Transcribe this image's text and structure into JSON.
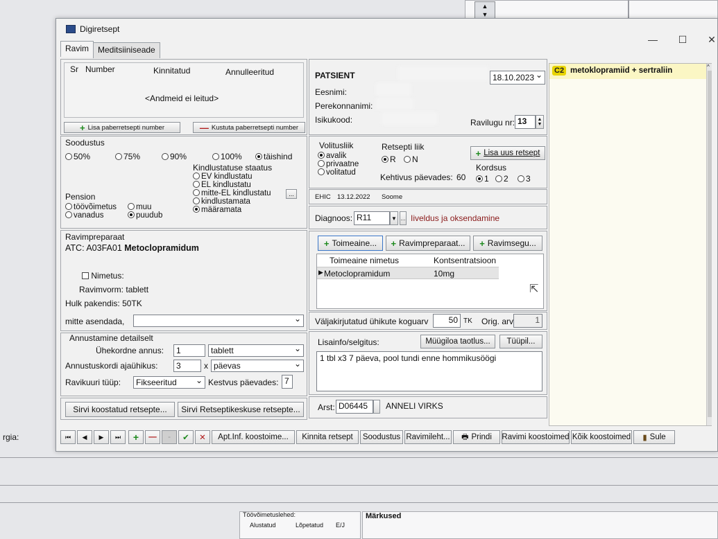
{
  "background": {
    "left_label": "rgia:",
    "lower_table": {
      "title": "Töövõimetuslehed:",
      "columns": [
        "Alustatud",
        "Lõpetatud",
        "E/J"
      ],
      "remarks": "Märkused"
    }
  },
  "window": {
    "title": "Digiretsept",
    "controls": [
      "—",
      "☐",
      "✕"
    ],
    "tabs": [
      "Ravim",
      "Meditsiiniseade"
    ]
  },
  "paper_rx": {
    "columns": [
      "Sr",
      "Number",
      "Kinnitatud",
      "Annulleeritud"
    ],
    "empty_text": "<Andmeid ei leitud>",
    "add_button": "Lisa paberretsepti number",
    "delete_button": "Kustuta paberretsepti number"
  },
  "discount": {
    "title": "Soodustus",
    "options": [
      "50%",
      "75%",
      "90%",
      "100%",
      "täishind"
    ],
    "selected": "täishind"
  },
  "insurance": {
    "title": "Kindlustatuse staatus",
    "options": [
      "EV kindlustatu",
      "EL kindlustatu",
      "mitte-EL kindlustatu",
      "kindlustamata",
      "määramata"
    ],
    "selected": "määramata"
  },
  "pension": {
    "title": "Pension",
    "options": [
      "töövõimetus",
      "muu",
      "vanadus",
      "puudub"
    ],
    "selected": "puudub"
  },
  "medicine": {
    "title": "Ravimpreparaat",
    "atc_label": "ATC:",
    "atc_code": "A03FA01",
    "atc_name": "Metoclopramidum",
    "name_label": "Nimetus:",
    "form_label": "Ravimvorm:",
    "form_value": "tablett",
    "pack_label": "Hulk pakendis:",
    "pack_value": "50TK",
    "substitute_label": "mitte asendada,"
  },
  "dosage": {
    "title": "Annustamine detailselt",
    "single_dose_label": "Ühekordne annus:",
    "single_dose_value": "1",
    "single_dose_unit": "tablett",
    "times_label": "Annustuskordi ajaühikus:",
    "times_value": "3",
    "times_x": "x",
    "time_unit": "päevas",
    "course_label": "Ravikuuri tüüp:",
    "course_value": "Fikseeritud",
    "duration_label": "Kestvus päevades:",
    "duration_value": "7"
  },
  "bottom_buttons": [
    "Sirvi koostatud retsepte...",
    "Sirvi Retseptikeskuse retsepte..."
  ],
  "patient": {
    "title": "PATSIENT",
    "date": "18.10.2023",
    "first_name_label": "Eesnimi:",
    "last_name_label": "Perekonnanimi:",
    "id_label": "Isikukood:",
    "visit_label": "Ravilugu nr:",
    "visit_value": "13"
  },
  "authorization": {
    "title": "Volitusliik",
    "options": [
      "avalik",
      "privaatne",
      "volitatud"
    ],
    "selected": "avalik"
  },
  "rx_type": {
    "title": "Retsepti liik",
    "options": [
      "R",
      "N"
    ],
    "selected": "R"
  },
  "new_rx_button": "Lisa uus retsept",
  "validity_label": "Kehtivus päevades:",
  "validity_value": "60",
  "repeats": {
    "title": "Kordsus",
    "options": [
      "1",
      "2",
      "3"
    ],
    "selected": "1"
  },
  "ehic": {
    "label": "EHIC",
    "date": "13.12.2022",
    "country": "Soome"
  },
  "diagnosis": {
    "label": "Diagnoos:",
    "code": "R11",
    "text": "Iiveldus ja oksendamine"
  },
  "substance": {
    "buttons": [
      "Toimeaine...",
      "Ravimpreparaat...",
      "Ravimsegu..."
    ],
    "columns": [
      "Toimeaine nimetus",
      "Kontsentratsioon"
    ],
    "rows": [
      {
        "name": "Metoclopramidum",
        "conc": "10mg"
      }
    ]
  },
  "quantity": {
    "label": "Väljakirjutatud ühikute koguarv",
    "value": "50",
    "unit": "TK",
    "orig_label": "Orig. arv",
    "orig_value": "1"
  },
  "info": {
    "label": "Lisainfo/selgitus:",
    "button1": "Müügiloa taotlus...",
    "button2": "Tüüpil...",
    "text": "1 tbl x3 7 päeva, pool tundi enne hommikusöögi"
  },
  "doctor": {
    "label": "Arst:",
    "code": "D06445",
    "name": "ANNELI VIRKS"
  },
  "side_panel": {
    "badge": "C2",
    "text": "metoklopramiid + sertraliin"
  },
  "toolbar": {
    "nav": [
      "⏮",
      "◀",
      "▶",
      "⏭"
    ],
    "add": "+",
    "remove": "—",
    "dash": "-",
    "confirm": "✔",
    "cancel": "✕",
    "buttons": [
      "Apt.Inf. koostoime...",
      "Kinnita retsept",
      "Soodustus",
      "Ravimileht...",
      "Prindi",
      "Ravimi koostoimed",
      "Kõik koostoimed",
      "Sule"
    ]
  },
  "colors": {
    "badge_bg": "#e8d400",
    "side_bg": "#fbf6c4",
    "diag_text": "#8a1a1a"
  }
}
